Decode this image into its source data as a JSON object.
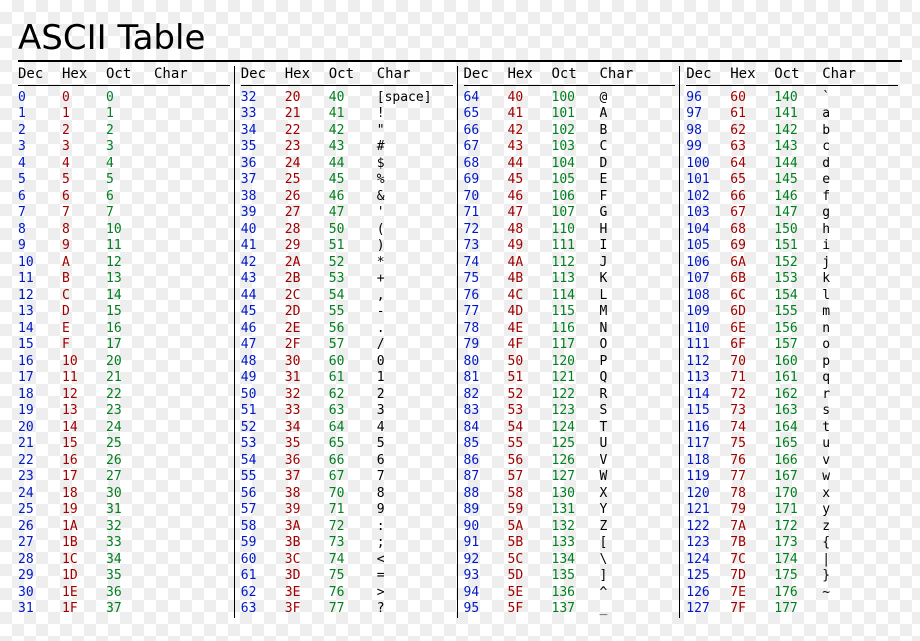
{
  "title": "ASCII Table",
  "headers": {
    "dec": "Dec",
    "hex": "Hex",
    "oct": "Oct",
    "char": "Char"
  },
  "blocks": [
    [
      {
        "dec": "0",
        "hex": "0",
        "oct": "0",
        "char": ""
      },
      {
        "dec": "1",
        "hex": "1",
        "oct": "1",
        "char": ""
      },
      {
        "dec": "2",
        "hex": "2",
        "oct": "2",
        "char": ""
      },
      {
        "dec": "3",
        "hex": "3",
        "oct": "3",
        "char": ""
      },
      {
        "dec": "4",
        "hex": "4",
        "oct": "4",
        "char": ""
      },
      {
        "dec": "5",
        "hex": "5",
        "oct": "5",
        "char": ""
      },
      {
        "dec": "6",
        "hex": "6",
        "oct": "6",
        "char": ""
      },
      {
        "dec": "7",
        "hex": "7",
        "oct": "7",
        "char": ""
      },
      {
        "dec": "8",
        "hex": "8",
        "oct": "10",
        "char": ""
      },
      {
        "dec": "9",
        "hex": "9",
        "oct": "11",
        "char": ""
      },
      {
        "dec": "10",
        "hex": "A",
        "oct": "12",
        "char": ""
      },
      {
        "dec": "11",
        "hex": "B",
        "oct": "13",
        "char": ""
      },
      {
        "dec": "12",
        "hex": "C",
        "oct": "14",
        "char": ""
      },
      {
        "dec": "13",
        "hex": "D",
        "oct": "15",
        "char": ""
      },
      {
        "dec": "14",
        "hex": "E",
        "oct": "16",
        "char": ""
      },
      {
        "dec": "15",
        "hex": "F",
        "oct": "17",
        "char": ""
      },
      {
        "dec": "16",
        "hex": "10",
        "oct": "20",
        "char": ""
      },
      {
        "dec": "17",
        "hex": "11",
        "oct": "21",
        "char": ""
      },
      {
        "dec": "18",
        "hex": "12",
        "oct": "22",
        "char": ""
      },
      {
        "dec": "19",
        "hex": "13",
        "oct": "23",
        "char": ""
      },
      {
        "dec": "20",
        "hex": "14",
        "oct": "24",
        "char": ""
      },
      {
        "dec": "21",
        "hex": "15",
        "oct": "25",
        "char": ""
      },
      {
        "dec": "22",
        "hex": "16",
        "oct": "26",
        "char": ""
      },
      {
        "dec": "23",
        "hex": "17",
        "oct": "27",
        "char": ""
      },
      {
        "dec": "24",
        "hex": "18",
        "oct": "30",
        "char": ""
      },
      {
        "dec": "25",
        "hex": "19",
        "oct": "31",
        "char": ""
      },
      {
        "dec": "26",
        "hex": "1A",
        "oct": "32",
        "char": ""
      },
      {
        "dec": "27",
        "hex": "1B",
        "oct": "33",
        "char": ""
      },
      {
        "dec": "28",
        "hex": "1C",
        "oct": "34",
        "char": ""
      },
      {
        "dec": "29",
        "hex": "1D",
        "oct": "35",
        "char": ""
      },
      {
        "dec": "30",
        "hex": "1E",
        "oct": "36",
        "char": ""
      },
      {
        "dec": "31",
        "hex": "1F",
        "oct": "37",
        "char": ""
      }
    ],
    [
      {
        "dec": "32",
        "hex": "20",
        "oct": "40",
        "char": "[space]"
      },
      {
        "dec": "33",
        "hex": "21",
        "oct": "41",
        "char": "!"
      },
      {
        "dec": "34",
        "hex": "22",
        "oct": "42",
        "char": "\""
      },
      {
        "dec": "35",
        "hex": "23",
        "oct": "43",
        "char": "#"
      },
      {
        "dec": "36",
        "hex": "24",
        "oct": "44",
        "char": "$"
      },
      {
        "dec": "37",
        "hex": "25",
        "oct": "45",
        "char": "%"
      },
      {
        "dec": "38",
        "hex": "26",
        "oct": "46",
        "char": "&"
      },
      {
        "dec": "39",
        "hex": "27",
        "oct": "47",
        "char": "'"
      },
      {
        "dec": "40",
        "hex": "28",
        "oct": "50",
        "char": "("
      },
      {
        "dec": "41",
        "hex": "29",
        "oct": "51",
        "char": ")"
      },
      {
        "dec": "42",
        "hex": "2A",
        "oct": "52",
        "char": "*"
      },
      {
        "dec": "43",
        "hex": "2B",
        "oct": "53",
        "char": "+"
      },
      {
        "dec": "44",
        "hex": "2C",
        "oct": "54",
        "char": ","
      },
      {
        "dec": "45",
        "hex": "2D",
        "oct": "55",
        "char": "-"
      },
      {
        "dec": "46",
        "hex": "2E",
        "oct": "56",
        "char": "."
      },
      {
        "dec": "47",
        "hex": "2F",
        "oct": "57",
        "char": "/"
      },
      {
        "dec": "48",
        "hex": "30",
        "oct": "60",
        "char": "0"
      },
      {
        "dec": "49",
        "hex": "31",
        "oct": "61",
        "char": "1"
      },
      {
        "dec": "50",
        "hex": "32",
        "oct": "62",
        "char": "2"
      },
      {
        "dec": "51",
        "hex": "33",
        "oct": "63",
        "char": "3"
      },
      {
        "dec": "52",
        "hex": "34",
        "oct": "64",
        "char": "4"
      },
      {
        "dec": "53",
        "hex": "35",
        "oct": "65",
        "char": "5"
      },
      {
        "dec": "54",
        "hex": "36",
        "oct": "66",
        "char": "6"
      },
      {
        "dec": "55",
        "hex": "37",
        "oct": "67",
        "char": "7"
      },
      {
        "dec": "56",
        "hex": "38",
        "oct": "70",
        "char": "8"
      },
      {
        "dec": "57",
        "hex": "39",
        "oct": "71",
        "char": "9"
      },
      {
        "dec": "58",
        "hex": "3A",
        "oct": "72",
        "char": ":"
      },
      {
        "dec": "59",
        "hex": "3B",
        "oct": "73",
        "char": ";"
      },
      {
        "dec": "60",
        "hex": "3C",
        "oct": "74",
        "char": "<"
      },
      {
        "dec": "61",
        "hex": "3D",
        "oct": "75",
        "char": "="
      },
      {
        "dec": "62",
        "hex": "3E",
        "oct": "76",
        "char": ">"
      },
      {
        "dec": "63",
        "hex": "3F",
        "oct": "77",
        "char": "?"
      }
    ],
    [
      {
        "dec": "64",
        "hex": "40",
        "oct": "100",
        "char": "@"
      },
      {
        "dec": "65",
        "hex": "41",
        "oct": "101",
        "char": "A"
      },
      {
        "dec": "66",
        "hex": "42",
        "oct": "102",
        "char": "B"
      },
      {
        "dec": "67",
        "hex": "43",
        "oct": "103",
        "char": "C"
      },
      {
        "dec": "68",
        "hex": "44",
        "oct": "104",
        "char": "D"
      },
      {
        "dec": "69",
        "hex": "45",
        "oct": "105",
        "char": "E"
      },
      {
        "dec": "70",
        "hex": "46",
        "oct": "106",
        "char": "F"
      },
      {
        "dec": "71",
        "hex": "47",
        "oct": "107",
        "char": "G"
      },
      {
        "dec": "72",
        "hex": "48",
        "oct": "110",
        "char": "H"
      },
      {
        "dec": "73",
        "hex": "49",
        "oct": "111",
        "char": "I"
      },
      {
        "dec": "74",
        "hex": "4A",
        "oct": "112",
        "char": "J"
      },
      {
        "dec": "75",
        "hex": "4B",
        "oct": "113",
        "char": "K"
      },
      {
        "dec": "76",
        "hex": "4C",
        "oct": "114",
        "char": "L"
      },
      {
        "dec": "77",
        "hex": "4D",
        "oct": "115",
        "char": "M"
      },
      {
        "dec": "78",
        "hex": "4E",
        "oct": "116",
        "char": "N"
      },
      {
        "dec": "79",
        "hex": "4F",
        "oct": "117",
        "char": "O"
      },
      {
        "dec": "80",
        "hex": "50",
        "oct": "120",
        "char": "P"
      },
      {
        "dec": "81",
        "hex": "51",
        "oct": "121",
        "char": "Q"
      },
      {
        "dec": "82",
        "hex": "52",
        "oct": "122",
        "char": "R"
      },
      {
        "dec": "83",
        "hex": "53",
        "oct": "123",
        "char": "S"
      },
      {
        "dec": "84",
        "hex": "54",
        "oct": "124",
        "char": "T"
      },
      {
        "dec": "85",
        "hex": "55",
        "oct": "125",
        "char": "U"
      },
      {
        "dec": "86",
        "hex": "56",
        "oct": "126",
        "char": "V"
      },
      {
        "dec": "87",
        "hex": "57",
        "oct": "127",
        "char": "W"
      },
      {
        "dec": "88",
        "hex": "58",
        "oct": "130",
        "char": "X"
      },
      {
        "dec": "89",
        "hex": "59",
        "oct": "131",
        "char": "Y"
      },
      {
        "dec": "90",
        "hex": "5A",
        "oct": "132",
        "char": "Z"
      },
      {
        "dec": "91",
        "hex": "5B",
        "oct": "133",
        "char": "["
      },
      {
        "dec": "92",
        "hex": "5C",
        "oct": "134",
        "char": "\\"
      },
      {
        "dec": "93",
        "hex": "5D",
        "oct": "135",
        "char": "]"
      },
      {
        "dec": "94",
        "hex": "5E",
        "oct": "136",
        "char": "^"
      },
      {
        "dec": "95",
        "hex": "5F",
        "oct": "137",
        "char": "_"
      }
    ],
    [
      {
        "dec": "96",
        "hex": "60",
        "oct": "140",
        "char": "`"
      },
      {
        "dec": "97",
        "hex": "61",
        "oct": "141",
        "char": "a"
      },
      {
        "dec": "98",
        "hex": "62",
        "oct": "142",
        "char": "b"
      },
      {
        "dec": "99",
        "hex": "63",
        "oct": "143",
        "char": "c"
      },
      {
        "dec": "100",
        "hex": "64",
        "oct": "144",
        "char": "d"
      },
      {
        "dec": "101",
        "hex": "65",
        "oct": "145",
        "char": "e"
      },
      {
        "dec": "102",
        "hex": "66",
        "oct": "146",
        "char": "f"
      },
      {
        "dec": "103",
        "hex": "67",
        "oct": "147",
        "char": "g"
      },
      {
        "dec": "104",
        "hex": "68",
        "oct": "150",
        "char": "h"
      },
      {
        "dec": "105",
        "hex": "69",
        "oct": "151",
        "char": "i"
      },
      {
        "dec": "106",
        "hex": "6A",
        "oct": "152",
        "char": "j"
      },
      {
        "dec": "107",
        "hex": "6B",
        "oct": "153",
        "char": "k"
      },
      {
        "dec": "108",
        "hex": "6C",
        "oct": "154",
        "char": "l"
      },
      {
        "dec": "109",
        "hex": "6D",
        "oct": "155",
        "char": "m"
      },
      {
        "dec": "110",
        "hex": "6E",
        "oct": "156",
        "char": "n"
      },
      {
        "dec": "111",
        "hex": "6F",
        "oct": "157",
        "char": "o"
      },
      {
        "dec": "112",
        "hex": "70",
        "oct": "160",
        "char": "p"
      },
      {
        "dec": "113",
        "hex": "71",
        "oct": "161",
        "char": "q"
      },
      {
        "dec": "114",
        "hex": "72",
        "oct": "162",
        "char": "r"
      },
      {
        "dec": "115",
        "hex": "73",
        "oct": "163",
        "char": "s"
      },
      {
        "dec": "116",
        "hex": "74",
        "oct": "164",
        "char": "t"
      },
      {
        "dec": "117",
        "hex": "75",
        "oct": "165",
        "char": "u"
      },
      {
        "dec": "118",
        "hex": "76",
        "oct": "166",
        "char": "v"
      },
      {
        "dec": "119",
        "hex": "77",
        "oct": "167",
        "char": "w"
      },
      {
        "dec": "120",
        "hex": "78",
        "oct": "170",
        "char": "x"
      },
      {
        "dec": "121",
        "hex": "79",
        "oct": "171",
        "char": "y"
      },
      {
        "dec": "122",
        "hex": "7A",
        "oct": "172",
        "char": "z"
      },
      {
        "dec": "123",
        "hex": "7B",
        "oct": "173",
        "char": "{"
      },
      {
        "dec": "124",
        "hex": "7C",
        "oct": "174",
        "char": "|"
      },
      {
        "dec": "125",
        "hex": "7D",
        "oct": "175",
        "char": "}"
      },
      {
        "dec": "126",
        "hex": "7E",
        "oct": "176",
        "char": "~"
      },
      {
        "dec": "127",
        "hex": "7F",
        "oct": "177",
        "char": ""
      }
    ]
  ]
}
